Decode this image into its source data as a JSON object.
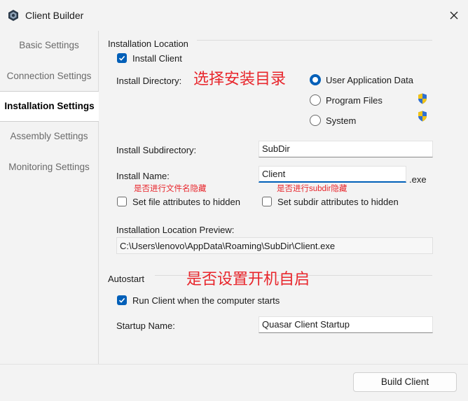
{
  "window": {
    "title": "Client Builder"
  },
  "sidebar": {
    "items": [
      {
        "label": "Basic Settings"
      },
      {
        "label": "Connection Settings"
      },
      {
        "label": "Installation Settings"
      },
      {
        "label": "Assembly Settings"
      },
      {
        "label": "Monitoring Settings"
      }
    ],
    "active_index": 2
  },
  "installation": {
    "section_title": "Installation Location",
    "install_client": {
      "label": "Install Client",
      "checked": true
    },
    "install_directory_label": "Install Directory:",
    "directory_options": [
      {
        "label": "User Application Data",
        "selected": true,
        "uac_shield": false
      },
      {
        "label": "Program Files",
        "selected": false,
        "uac_shield": true
      },
      {
        "label": "System",
        "selected": false,
        "uac_shield": true
      }
    ],
    "subdirectory": {
      "label": "Install Subdirectory:",
      "value": "SubDir"
    },
    "install_name": {
      "label": "Install Name:",
      "value": "Client",
      "suffix": ".exe"
    },
    "hide_file": {
      "label": "Set file attributes to hidden",
      "checked": false
    },
    "hide_subdir": {
      "label": "Set subdir attributes to hidden",
      "checked": false
    },
    "preview": {
      "label": "Installation Location Preview:",
      "value": "C:\\Users\\lenovo\\AppData\\Roaming\\SubDir\\Client.exe"
    }
  },
  "autostart": {
    "section_title": "Autostart",
    "run_on_start": {
      "label": "Run Client when the computer starts",
      "checked": true
    },
    "startup_name": {
      "label": "Startup Name:",
      "value": "Quasar Client Startup"
    }
  },
  "annotations": {
    "directory_note": "选择安装目录",
    "name_note": "是否进行文件名隐藏",
    "subdir_note": "是否进行subdir隐藏",
    "autostart_note": "是否设置开机自启"
  },
  "footer": {
    "build_label": "Build Client"
  },
  "colors": {
    "accent": "#005fb8",
    "annotation_red": "#e8262c"
  }
}
